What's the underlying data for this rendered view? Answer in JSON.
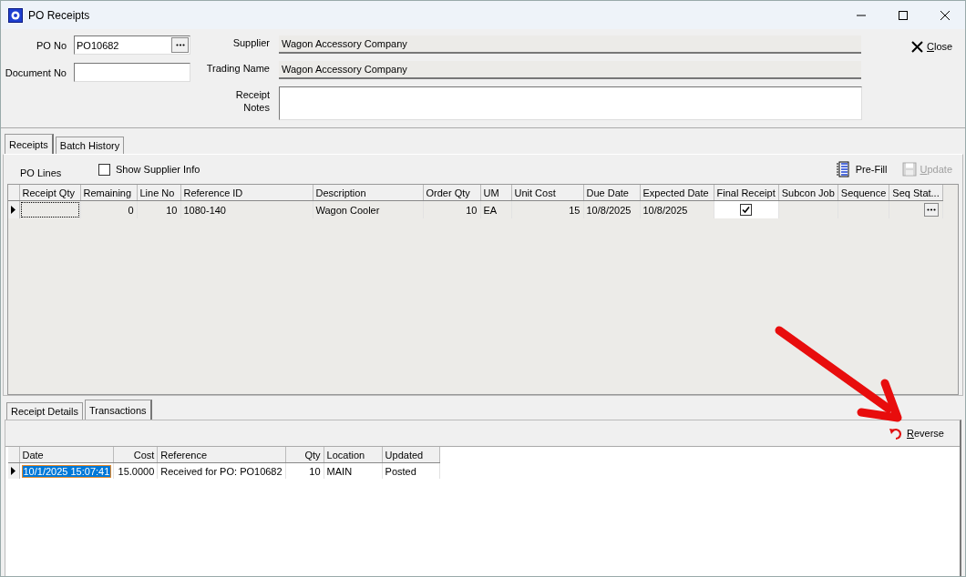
{
  "window": {
    "title": "PO Receipts"
  },
  "header": {
    "po_no": {
      "label": "PO No",
      "value": "PO10682"
    },
    "document_no": {
      "label": "Document No"
    },
    "supplier": {
      "label": "Supplier",
      "value": "Wagon Accessory Company"
    },
    "trading_name": {
      "label": "Trading Name",
      "value": "Wagon Accessory Company"
    },
    "receipt_notes": {
      "label": "Receipt\nNotes"
    },
    "close_button": {
      "label": "Close"
    }
  },
  "tabs": [
    {
      "label": "Receipts",
      "selected": true
    },
    {
      "label": "Batch History",
      "selected": false
    }
  ],
  "po_lines": {
    "label": "PO Lines",
    "show_supplier_info": {
      "label": "Show Supplier Info",
      "checked": false
    },
    "prefill_button": {
      "label": "Pre-Fill",
      "disabled": false
    },
    "update_button": {
      "label": "Update",
      "disabled": true
    },
    "columns": [
      "Receipt Qty",
      "Remaining",
      "Line No",
      "Reference ID",
      "Description",
      "Order Qty",
      "UM",
      "Unit Cost",
      "Due Date",
      "Expected Date",
      "Final Receipt",
      "Subcon Job",
      "Sequence",
      "Seq Stat..."
    ],
    "rows": [
      {
        "current": true,
        "cells": [
          {
            "kind": "focus"
          },
          {
            "kind": "number",
            "text": "0"
          },
          {
            "kind": "number",
            "text": "10"
          },
          {
            "kind": "text",
            "text": "1080-140"
          },
          {
            "kind": "text",
            "text": "Wagon Cooler"
          },
          {
            "kind": "number",
            "text": "10"
          },
          {
            "kind": "text",
            "text": "EA"
          },
          {
            "kind": "number",
            "text": "15"
          },
          {
            "kind": "text",
            "text": "10/8/2025"
          },
          {
            "kind": "text",
            "text": "10/8/2025"
          },
          {
            "kind": "check",
            "checked": true
          },
          {
            "kind": "blank"
          },
          {
            "kind": "blank"
          },
          {
            "kind": "ellipsis"
          }
        ]
      }
    ]
  },
  "bottom_tabs": [
    {
      "label": "Receipt Details",
      "selected": false
    },
    {
      "label": "Transactions",
      "selected": true
    }
  ],
  "transactions": {
    "reverse_button": {
      "label": "Reverse"
    },
    "columns": [
      "Date",
      "Cost",
      "Reference",
      "Qty",
      "Location",
      "Updated"
    ],
    "rows": [
      {
        "current": true,
        "cells": [
          {
            "kind": "text",
            "text": "10/1/2025 15:07:41",
            "selected": true
          },
          {
            "kind": "number",
            "text": "15.0000",
            "selected": false
          },
          {
            "kind": "text",
            "text": "Received for PO: PO10682",
            "selected": false
          },
          {
            "kind": "number",
            "text": "10",
            "selected": false
          },
          {
            "kind": "text",
            "text": "MAIN",
            "selected": false
          },
          {
            "kind": "text",
            "text": "Posted",
            "selected": false
          }
        ]
      }
    ]
  },
  "annotation": {
    "kind": "arrow"
  }
}
